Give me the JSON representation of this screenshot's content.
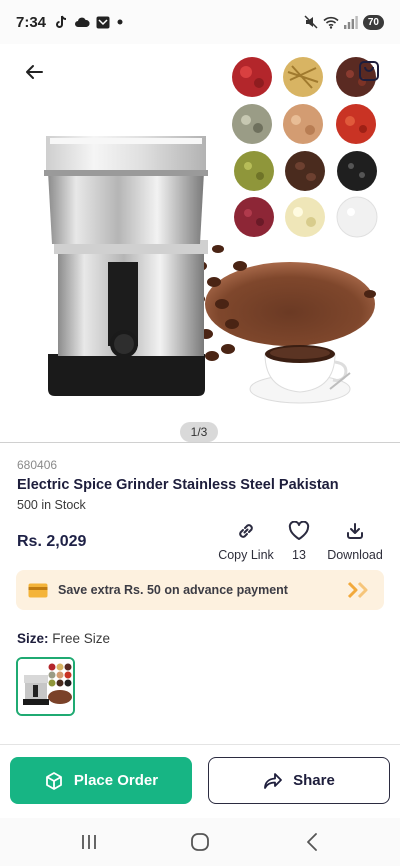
{
  "status_bar": {
    "time": "7:34",
    "battery": "70",
    "left_icons": [
      "tiktok-icon",
      "cloud-icon",
      "mail-icon",
      "dot-icon"
    ],
    "right_icons": [
      "mute-icon",
      "wifi-icon",
      "signal-icon",
      "battery-icon"
    ]
  },
  "gallery": {
    "pager": "1/3",
    "current_index": 1,
    "total": 3
  },
  "product": {
    "sku": "680406",
    "title": "Electric Spice Grinder Stainless Steel Pakistan",
    "stock": "500 in Stock",
    "price": "Rs. 2,029"
  },
  "actions": {
    "copy_link": "Copy Link",
    "favorites_count": "13",
    "download": "Download"
  },
  "promo": {
    "text": "Save extra Rs. 50 on advance payment"
  },
  "size": {
    "label": "Size:",
    "value": "Free Size"
  },
  "buttons": {
    "place_order": "Place Order",
    "share": "Share"
  },
  "colors": {
    "accent_green": "#17b584",
    "title_navy": "#1e1e3c",
    "promo_bg": "#fdf1df",
    "promo_chevron": "#f2a93b"
  }
}
